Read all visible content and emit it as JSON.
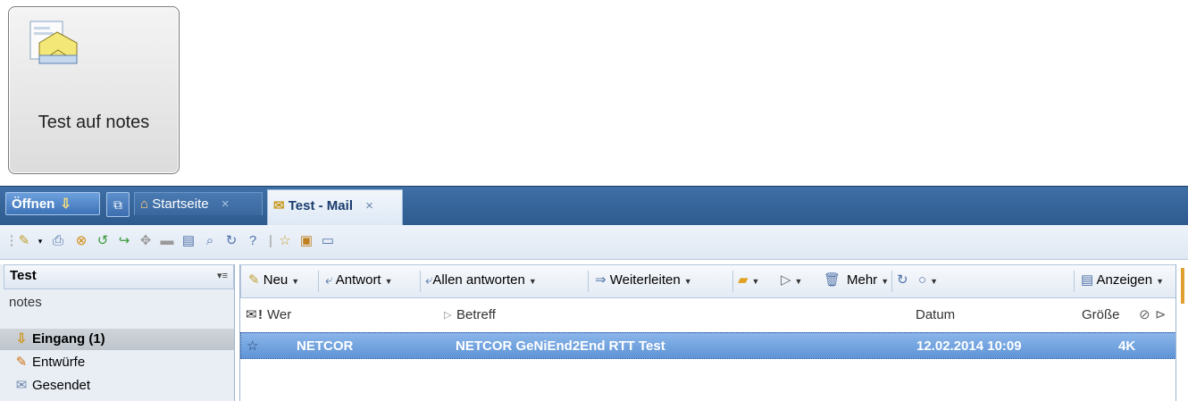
{
  "app_tile": {
    "label": "Test auf notes",
    "icon": "mail-envelope-icon"
  },
  "tabs": {
    "open_label": "Öffnen",
    "home_label": "Startseite",
    "mail_label": "Test - Mail",
    "close_glyph": "×"
  },
  "folders": {
    "header": "Test",
    "subheader": "notes",
    "items": [
      {
        "label": "Eingang (1)",
        "icon": "inbox-icon",
        "selected": true
      },
      {
        "label": "Entwürfe",
        "icon": "drafts-icon",
        "selected": false
      },
      {
        "label": "Gesendet",
        "icon": "sent-icon",
        "selected": false
      }
    ]
  },
  "mail_toolbar": {
    "new": "Neu",
    "reply": "Antwort",
    "reply_all": "Allen antworten",
    "forward": "Weiterleiten",
    "more": "Mehr",
    "view": "Anzeigen"
  },
  "columns": {
    "who": "Wer",
    "subject": "Betreff",
    "date": "Datum",
    "size": "Größe"
  },
  "messages": [
    {
      "from": "NETCOR",
      "subject": "NETCOR GeNiEnd2End RTT Test",
      "date": "12.02.2014 10:09",
      "size": "4K"
    }
  ],
  "colors": {
    "tabbar": "#2e5a8e",
    "selection": "#6f9fdc",
    "pane_bg": "#e9eef5"
  }
}
